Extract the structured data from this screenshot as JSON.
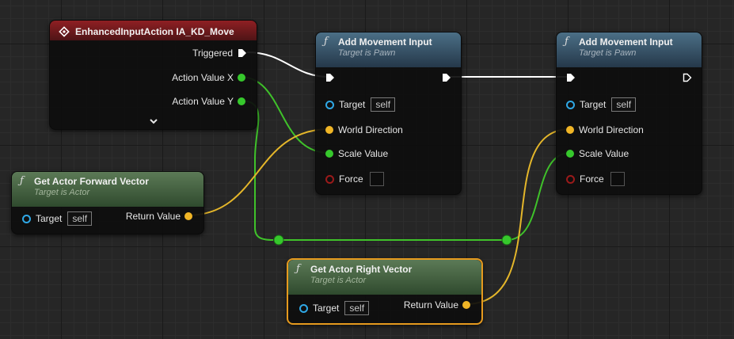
{
  "colors": {
    "exec_wire": "#ffffff",
    "float_wire": "#3fc22a",
    "vector_wire": "#e4b62a",
    "event_header": "#8f1f23",
    "function_header": "#4b6f86",
    "pure_function_header": "#5c7a56",
    "selection_outline": "#e69a1e"
  },
  "event_node": {
    "title": "EnhancedInputAction IA_KD_Move",
    "icon": "enhanced-input-action-icon",
    "outputs": {
      "triggered": "Triggered",
      "action_value_x": "Action Value X",
      "action_value_y": "Action Value Y"
    },
    "expand_icon": "chevron-down-icon"
  },
  "forward_node": {
    "title": "Get Actor Forward Vector",
    "subtitle": "Target is Actor",
    "target_label": "Target",
    "target_value": "self",
    "return_label": "Return Value"
  },
  "right_node": {
    "title": "Get Actor Right Vector",
    "subtitle": "Target is Actor",
    "target_label": "Target",
    "target_value": "self",
    "return_label": "Return Value"
  },
  "move_node_1": {
    "title": "Add Movement Input",
    "subtitle": "Target is Pawn",
    "target_label": "Target",
    "target_value": "self",
    "world_direction_label": "World Direction",
    "scale_value_label": "Scale Value",
    "force_label": "Force"
  },
  "move_node_2": {
    "title": "Add Movement Input",
    "subtitle": "Target is Pawn",
    "target_label": "Target",
    "target_value": "self",
    "world_direction_label": "World Direction",
    "scale_value_label": "Scale Value",
    "force_label": "Force"
  }
}
